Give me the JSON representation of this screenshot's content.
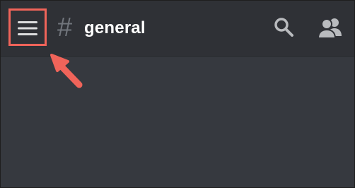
{
  "header": {
    "channel_prefix": "#",
    "channel_name": "general"
  },
  "icons": {
    "menu": "hamburger-menu-icon",
    "search": "search-icon",
    "members": "members-icon"
  },
  "colors": {
    "header_bg": "#2f3136",
    "content_bg": "#36393f",
    "text_primary": "#ffffff",
    "hash_color": "#72767d",
    "icon_color": "#b9bbbe",
    "annotation": "#f0645a"
  }
}
